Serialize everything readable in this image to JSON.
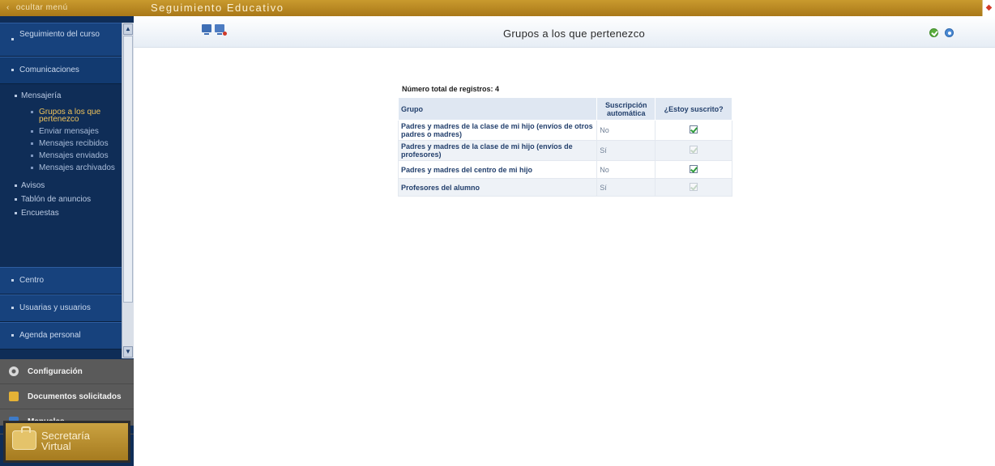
{
  "topbar": {
    "hide_menu_label": "ocultar menú",
    "app_title": "Seguimiento Educativo"
  },
  "sidebar": {
    "sections": [
      {
        "label": "Seguimiento del curso"
      },
      {
        "label": "Comunicaciones"
      }
    ],
    "comunicaciones": {
      "mensajeria": "Mensajería",
      "mensajeria_items": [
        {
          "label": "Grupos a los que pertenezco",
          "active": true
        },
        {
          "label": "Enviar mensajes"
        },
        {
          "label": "Mensajes recibidos"
        },
        {
          "label": "Mensajes enviados"
        },
        {
          "label": "Mensajes archivados"
        }
      ],
      "other_items": [
        {
          "label": "Avisos"
        },
        {
          "label": "Tablón de anuncios"
        },
        {
          "label": "Encuestas"
        }
      ]
    },
    "lower_sections": [
      {
        "label": "Centro"
      },
      {
        "label": "Usuarias y usuarios"
      },
      {
        "label": "Agenda personal"
      }
    ],
    "bottom_menu": [
      {
        "label": "Configuración",
        "icon": "gear-icon"
      },
      {
        "label": "Documentos solicitados",
        "icon": "folder-icon"
      },
      {
        "label": "Manuales",
        "icon": "book-icon"
      }
    ],
    "secretaria": {
      "line1": "Secretaría",
      "line2": "Virtual"
    }
  },
  "main": {
    "page_title": "Grupos a los que pertenezco",
    "record_count": "Número total de registros: 4",
    "table": {
      "headers": [
        "Grupo",
        "Suscripción automática",
        "¿Estoy suscrito?"
      ],
      "rows": [
        {
          "group": "Padres y madres de la clase de mi hijo (envíos de otros padres o madres)",
          "auto": "No",
          "subscribed": true,
          "editable": true
        },
        {
          "group": "Padres y madres de la clase de mi hijo (envíos de profesores)",
          "auto": "Sí",
          "subscribed": true,
          "editable": false
        },
        {
          "group": "Padres y madres del centro de mi hijo",
          "auto": "No",
          "subscribed": true,
          "editable": true
        },
        {
          "group": "Profesores del alumno",
          "auto": "Sí",
          "subscribed": true,
          "editable": false
        }
      ]
    }
  },
  "colors": {
    "topbar": "#b8891f",
    "sidebar": "#0f2d57",
    "section": "#17427d",
    "active_item": "#f0c35a",
    "table_header": "#dfe7f2"
  }
}
